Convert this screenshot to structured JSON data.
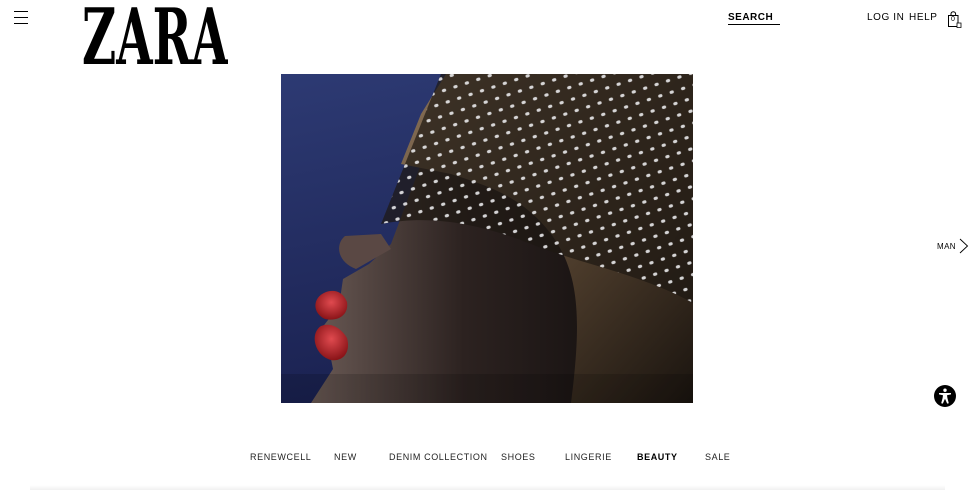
{
  "header": {
    "brand": "ZARA",
    "search_label": "SEARCH",
    "login_label": "LOG IN",
    "help_label": "HELP",
    "bag_count": "0",
    "menu_icon": "hamburger-menu-icon",
    "bag_icon": "shopping-bag-icon"
  },
  "side_nav": {
    "next_section_label": "MAN",
    "arrow_icon": "chevron-right-icon"
  },
  "accessibility": {
    "icon": "accessibility-icon",
    "color": "#000000"
  },
  "categories": [
    {
      "label": "RENEWCELL",
      "active": false
    },
    {
      "label": "NEW",
      "active": false
    },
    {
      "label": "DENIM COLLECTION",
      "active": false
    },
    {
      "label": "SHOES",
      "active": false
    },
    {
      "label": "LINGERIE",
      "active": false
    },
    {
      "label": "BEAUTY",
      "active": true
    },
    {
      "label": "SALE",
      "active": false
    }
  ],
  "colors": {
    "background": "#ffffff",
    "text": "#000000",
    "hero_sky": "#2a3466",
    "lip": "#b8232a"
  }
}
